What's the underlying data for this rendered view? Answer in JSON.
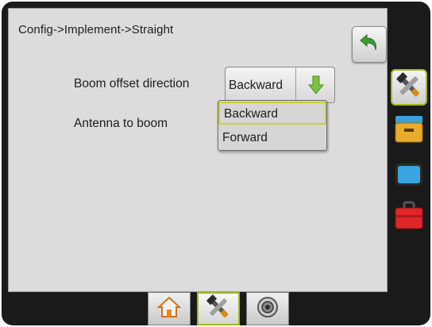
{
  "header": {
    "breadcrumb": "Config->Implement->Straight"
  },
  "fields": {
    "boom_offset_direction": {
      "label": "Boom offset direction",
      "value": "Backward"
    },
    "antenna_to_boom": {
      "label": "Antenna to boom"
    }
  },
  "dropdown": {
    "options": [
      "Backward",
      "Forward"
    ],
    "selected": "Backward"
  },
  "sidebar": {
    "items": [
      {
        "icon": "tools-icon",
        "active": true
      },
      {
        "icon": "console-icon",
        "active": false
      },
      {
        "icon": "display-icon",
        "active": false
      },
      {
        "icon": "toolbox-icon",
        "active": false
      }
    ]
  },
  "bottom_nav": {
    "items": [
      {
        "icon": "home-icon",
        "active": false
      },
      {
        "icon": "tools-icon",
        "active": true
      },
      {
        "icon": "gauge-icon",
        "active": false
      }
    ]
  },
  "colors": {
    "accent_green": "#7cc242",
    "active_border": "#9fba28",
    "back_green": "#3f9a38"
  }
}
